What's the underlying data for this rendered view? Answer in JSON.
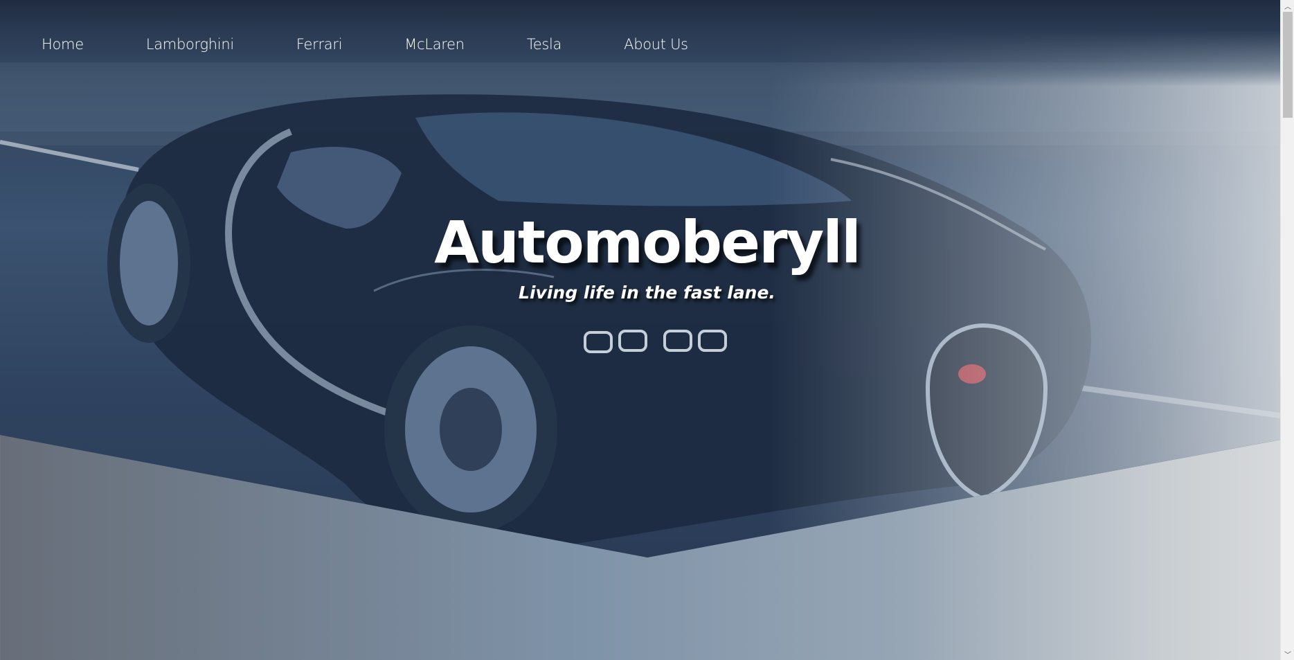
{
  "nav": {
    "items": [
      {
        "label": "Home"
      },
      {
        "label": "Lamborghini"
      },
      {
        "label": "Ferrari"
      },
      {
        "label": "McLaren"
      },
      {
        "label": "Tesla"
      },
      {
        "label": "About Us"
      }
    ]
  },
  "hero": {
    "title": "Automoberyll",
    "subtitle": "Living life in the fast lane.",
    "image_icon": "car-photo"
  },
  "scrollbar": {
    "up_icon": "chevron-up-icon",
    "down_icon": "chevron-down-icon",
    "up_glyph": "︿",
    "down_glyph": "﹀"
  },
  "colors": {
    "text": "#ffffff",
    "hero_dark": "#2b3d58",
    "background_light": "#d9dbdc",
    "background_dark": "#676e79"
  }
}
